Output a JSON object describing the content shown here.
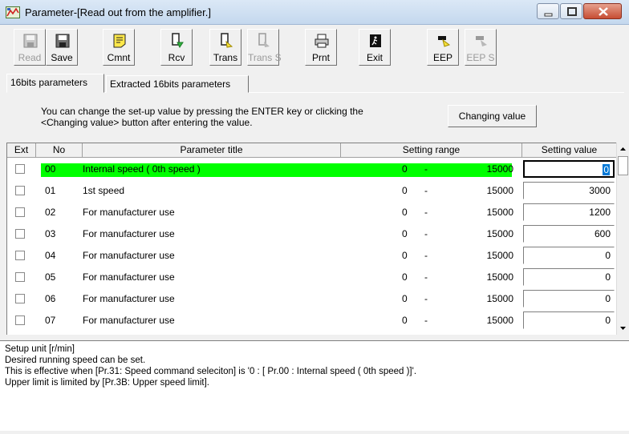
{
  "window": {
    "title": "Parameter-[Read out from the amplifier.]"
  },
  "toolbar": {
    "buttons": [
      {
        "label": "Read",
        "icon": "floppy-disk-icon",
        "enabled": false
      },
      {
        "label": "Save",
        "icon": "floppy-disk-icon",
        "enabled": true
      },
      {
        "label": "Cmnt",
        "icon": "comment-note-icon",
        "enabled": true
      },
      {
        "label": "Rcv",
        "icon": "receive-icon",
        "enabled": true
      },
      {
        "label": "Trans",
        "icon": "transmit-icon",
        "enabled": true
      },
      {
        "label": "Trans S",
        "icon": "transmit-single-icon",
        "enabled": false
      },
      {
        "label": "Prnt",
        "icon": "printer-icon",
        "enabled": true
      },
      {
        "label": "Exit",
        "icon": "exit-door-icon",
        "enabled": true
      },
      {
        "label": "EEP",
        "icon": "eeprom-write-icon",
        "enabled": true
      },
      {
        "label": "EEP S",
        "icon": "eeprom-write-single-icon",
        "enabled": false
      }
    ]
  },
  "tabs": [
    {
      "label": "16bits parameters",
      "active": true
    },
    {
      "label": "Extracted 16bits parameters",
      "active": false
    }
  ],
  "instructions": {
    "line1": "You can change the set-up value by pressing the ENTER key or clicking the",
    "line2": "<Changing value> button after entering the value."
  },
  "change_button": {
    "label": "Changing value"
  },
  "table": {
    "headers": {
      "ext": "Ext",
      "no": "No",
      "title": "Parameter title",
      "range": "Setting range",
      "value": "Setting value"
    },
    "range_separator": "-",
    "rows": [
      {
        "no": "00",
        "title": "Internal speed ( 0th speed )",
        "min": "0",
        "max": "15000",
        "value": "0",
        "selected": true
      },
      {
        "no": "01",
        "title": "1st speed",
        "min": "0",
        "max": "15000",
        "value": "3000",
        "selected": false
      },
      {
        "no": "02",
        "title": "For manufacturer use",
        "min": "0",
        "max": "15000",
        "value": "1200",
        "selected": false
      },
      {
        "no": "03",
        "title": "For manufacturer use",
        "min": "0",
        "max": "15000",
        "value": "600",
        "selected": false
      },
      {
        "no": "04",
        "title": "For manufacturer use",
        "min": "0",
        "max": "15000",
        "value": "0",
        "selected": false
      },
      {
        "no": "05",
        "title": "For manufacturer use",
        "min": "0",
        "max": "15000",
        "value": "0",
        "selected": false
      },
      {
        "no": "06",
        "title": "For manufacturer use",
        "min": "0",
        "max": "15000",
        "value": "0",
        "selected": false
      },
      {
        "no": "07",
        "title": "For manufacturer use",
        "min": "0",
        "max": "15000",
        "value": "0",
        "selected": false
      }
    ]
  },
  "info": {
    "lines": [
      "Setup unit [r/min]",
      "Desired running speed can be set.",
      "This is effective when [Pr.31: Speed command seleciton] is '0 : [ Pr.00 : Internal speed ( 0th speed )]'.",
      "Upper limit is limited by [Pr.3B: Upper speed limit]."
    ]
  },
  "colors": {
    "highlight": "#00ff00",
    "close_button": "#c74d34"
  }
}
